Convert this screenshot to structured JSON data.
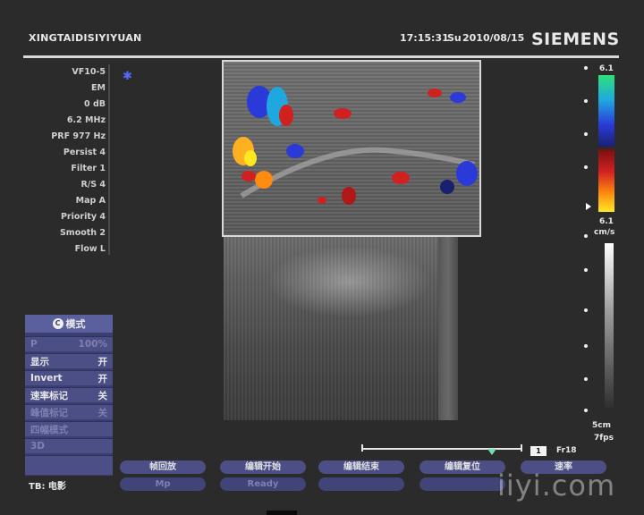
{
  "header": {
    "hospital": "XINGTAIDISIYIYUAN",
    "time": "17:15:31",
    "day": "Su",
    "date": "2010/08/15",
    "brand": "SIEMENS"
  },
  "params": [
    "VF10-5",
    "EM",
    "0 dB",
    "6.2 MHz",
    "PRF 977 Hz",
    "Persist 4",
    "Filter 1",
    "R/S 4",
    "Map A",
    "Priority 4",
    "Smooth 2",
    "Flow L"
  ],
  "scale": {
    "top_value": "6.1",
    "bottom_value": "6.1",
    "unit": "cm/s",
    "depth": "5cm",
    "fps": "7fps"
  },
  "cine": {
    "frame_box": "1",
    "frame_label": "Fr18"
  },
  "menu": {
    "title": "模式",
    "title_icon": "C",
    "rows": [
      {
        "label": "P",
        "value": "100%",
        "dim": true
      },
      {
        "label": "显示",
        "value": "开",
        "dim": false
      },
      {
        "label": "Invert",
        "value": "开",
        "dim": false
      },
      {
        "label": "速率标记",
        "value": "关",
        "dim": false
      },
      {
        "label": "峰值标记",
        "value": "关",
        "dim": true
      },
      {
        "label": "四幅模式",
        "value": "",
        "dim": true
      },
      {
        "label": "3D",
        "value": "",
        "dim": true
      }
    ],
    "tb_label": "TB: 电影"
  },
  "softkeys": {
    "row1": [
      "帧回放",
      "编辑开始",
      "编辑结束",
      "编辑复位",
      "速率"
    ],
    "row2": [
      "Mp",
      "Ready",
      "",
      "",
      ""
    ]
  },
  "watermark": "iiyi.com",
  "colors": {
    "menu_bg": "#3c3f6e",
    "menu_row": "#4b4f86",
    "frame_marker": "#6fe0b0"
  }
}
